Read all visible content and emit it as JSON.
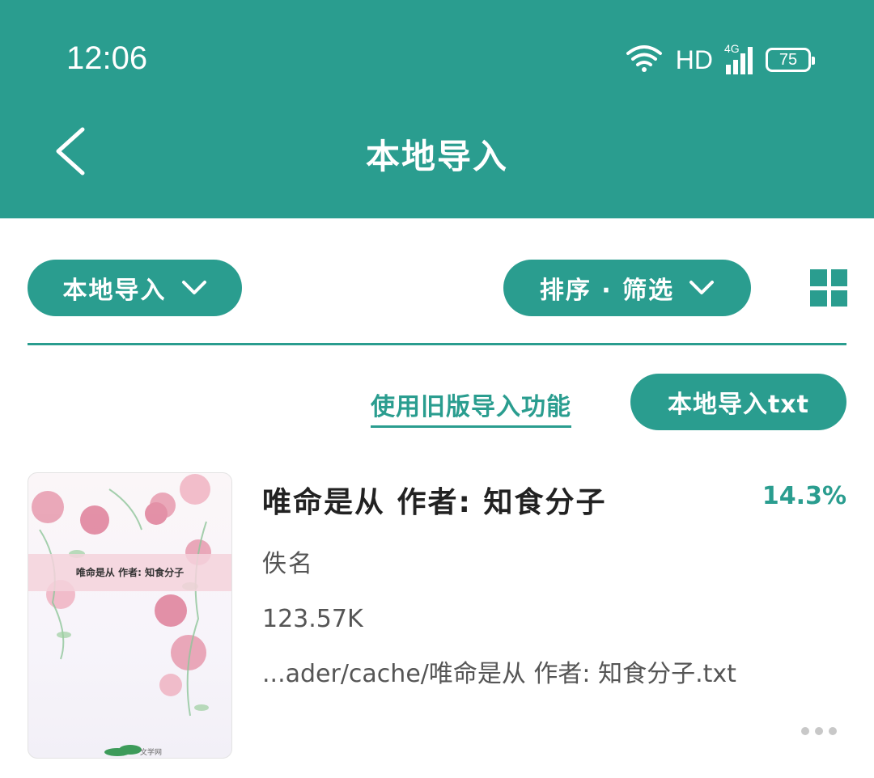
{
  "status_bar": {
    "time": "12:06",
    "network_label": "HD",
    "cellular_label": "4G",
    "battery": "75"
  },
  "header": {
    "title": "本地导入",
    "back_icon": "chevron-left-icon"
  },
  "filters": {
    "source_label": "本地导入",
    "sort_label": "排序 · 筛选",
    "view_toggle_icon": "grid-view-icon"
  },
  "actions": {
    "legacy_import_label": "使用旧版导入功能",
    "import_txt_label": "本地导入txt"
  },
  "books": [
    {
      "title": "唯命是从 作者: 知食分子",
      "progress": "14.3%",
      "author": "佚名",
      "size": "123.57K",
      "path": "...ader/cache/唯命是从 作者: 知食分子.txt",
      "cover_title": "唯命是从 作者: 知食分子",
      "more_icon": "more-icon"
    }
  ],
  "colors": {
    "accent": "#2a9d8f",
    "background": "#ffffff",
    "text_primary": "#222222",
    "text_secondary": "#555555"
  }
}
